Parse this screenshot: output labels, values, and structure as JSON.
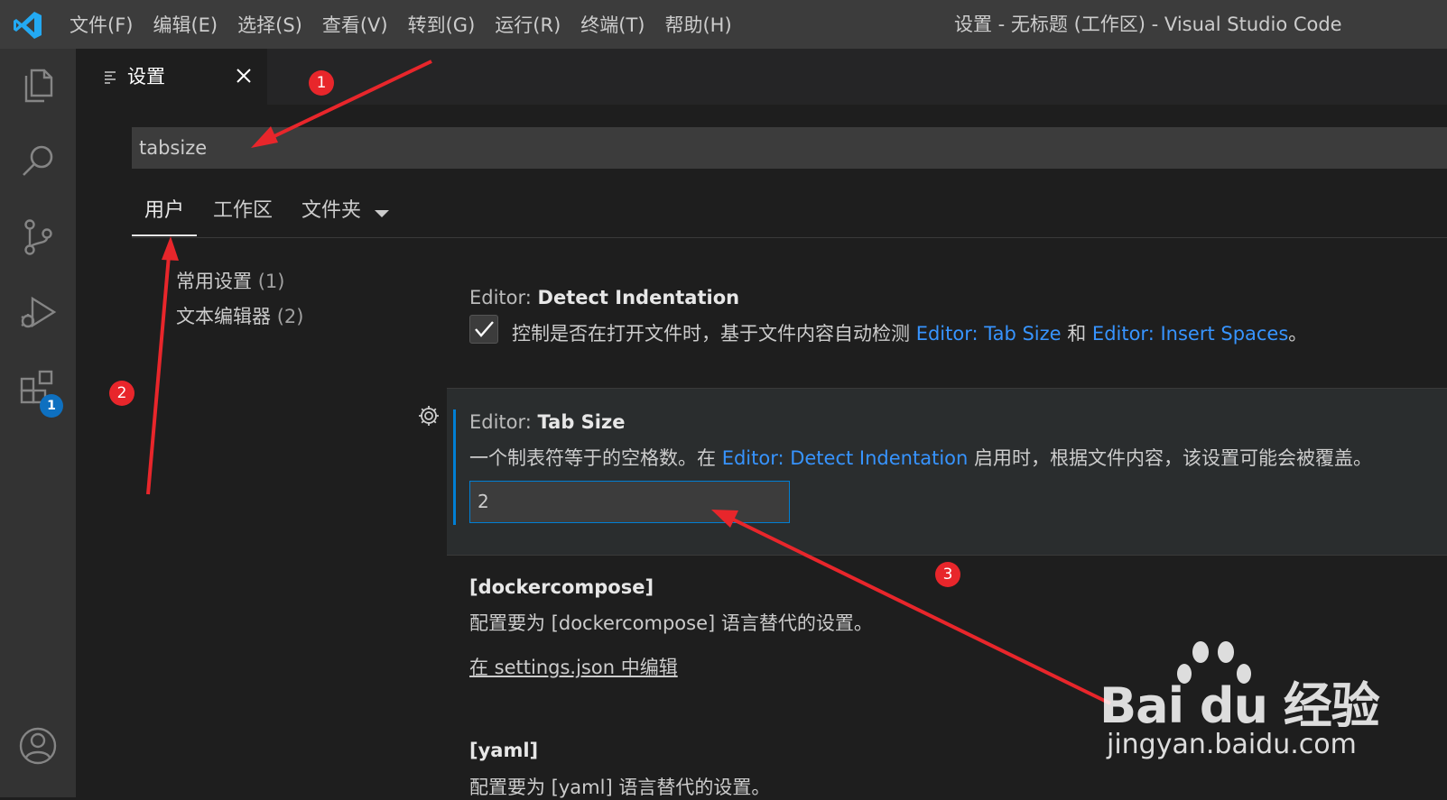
{
  "menu": {
    "items": [
      "文件(F)",
      "编辑(E)",
      "选择(S)",
      "查看(V)",
      "转到(G)",
      "运行(R)",
      "终端(T)",
      "帮助(H)"
    ],
    "window_title": "设置 - 无标题 (工作区) - Visual Studio Code"
  },
  "activity_bar": {
    "icons": [
      "files-icon",
      "search-icon",
      "source-control-icon",
      "run-debug-icon",
      "extensions-icon",
      "account-icon"
    ],
    "extensions_badge": "1"
  },
  "editor_tab": {
    "label": "设置"
  },
  "search": {
    "value": "tabsize"
  },
  "scope_tabs": {
    "user": "用户",
    "workspace": "工作区",
    "folder": "文件夹"
  },
  "toc": {
    "items": [
      {
        "label": "常用设置",
        "count": "(1)"
      },
      {
        "label": "文本编辑器",
        "count": "(2)"
      }
    ]
  },
  "settings": {
    "detect_indentation": {
      "category": "Editor: ",
      "name": "Detect Indentation",
      "checked": true,
      "desc_prefix": "控制是否在打开文件时，基于文件内容自动检测 ",
      "link1": "Editor: Tab Size",
      "desc_mid": " 和 ",
      "link2": "Editor: Insert Spaces",
      "desc_suffix": "。"
    },
    "tab_size": {
      "category": "Editor: ",
      "name": "Tab Size",
      "desc_prefix": "一个制表符等于的空格数。在 ",
      "link": "Editor: Detect Indentation",
      "desc_suffix": " 启用时，根据文件内容，该设置可能会被覆盖。",
      "value": "2"
    },
    "dockercompose": {
      "name": "[dockercompose]",
      "desc": "配置要为 [dockercompose] 语言替代的设置。",
      "edit_link": "在 settings.json 中编辑"
    },
    "yaml": {
      "name": "[yaml]",
      "desc": "配置要为 [yaml] 语言替代的设置。"
    }
  },
  "annotations": {
    "markers": [
      "1",
      "2",
      "3"
    ],
    "color": "#e8262b"
  },
  "watermark": {
    "brand": "Bai du 经验",
    "url": "jingyan.baidu.com"
  },
  "colors": {
    "accent": "#007fd4",
    "link": "#3794ff",
    "badge": "#0e70c0"
  }
}
